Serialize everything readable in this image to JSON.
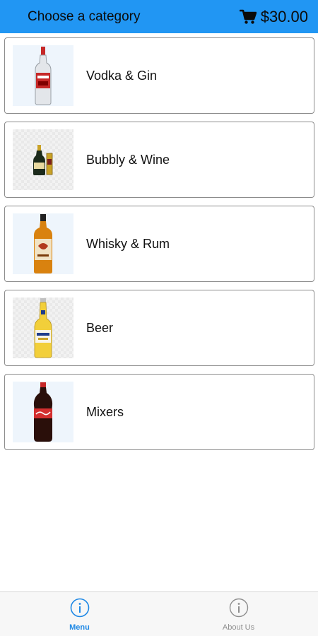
{
  "header": {
    "title": "Choose a category",
    "cart_icon": "shopping-cart-icon",
    "cart_total": "$30.00"
  },
  "categories": [
    {
      "label": "Vodka & Gin",
      "icon": "vodka-bottle"
    },
    {
      "label": "Bubbly & Wine",
      "icon": "champagne-bottle"
    },
    {
      "label": "Whisky & Rum",
      "icon": "whisky-bottle"
    },
    {
      "label": "Beer",
      "icon": "beer-bottle"
    },
    {
      "label": "Mixers",
      "icon": "cola-bottle"
    }
  ],
  "tabs": [
    {
      "label": "Menu",
      "icon": "info-icon",
      "active": true
    },
    {
      "label": "About Us",
      "icon": "info-icon",
      "active": false
    }
  ],
  "colors": {
    "header_bg": "#2196f3",
    "active_tab": "#1e88e5",
    "inactive_tab": "#8e8e8e"
  }
}
